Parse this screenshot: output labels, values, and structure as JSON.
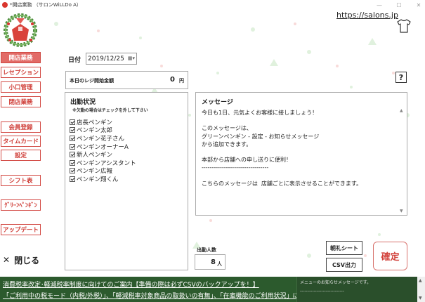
{
  "window": {
    "title": "*開店業務 （サロンWiLLDo A）",
    "minimize": "—",
    "maximize": "☐",
    "close": "✕"
  },
  "header": {
    "url": "https://salons.jp"
  },
  "sidebar": {
    "items": [
      {
        "label": "開店業務"
      },
      {
        "label": "レセプション"
      },
      {
        "label": "小口管理"
      },
      {
        "label": "閉店業務"
      },
      {
        "label": "会員登録"
      },
      {
        "label": "タイムカード"
      },
      {
        "label": "設定"
      },
      {
        "label": "シフト表"
      },
      {
        "label": "ｸﾞﾘｰﾝﾍﾟﾝｷﾞﾝ"
      },
      {
        "label": "アップデート"
      }
    ],
    "close_icon": "✕",
    "close_label": "閉じる"
  },
  "date": {
    "label": "日付",
    "value": "2019/12/25"
  },
  "register": {
    "label": "本日のレジ開始金額",
    "value": "0",
    "unit": "円"
  },
  "help": {
    "label": "?"
  },
  "attendance": {
    "title": "出勤状況",
    "note": "※欠勤の場合はチェックを外して下さい",
    "staff": [
      "店長ペンギン",
      "ペンギン太郎",
      "ペンギン花子さん",
      "ペンギンオーナーA",
      "新人ペンギン",
      "ペンギンアシスタント",
      "ペンギン広報",
      "ペンギン翔くん"
    ]
  },
  "message": {
    "title": "メッセージ",
    "body": "今日も1日、元気よくお客様に接しましょう！\n\nこのメッセージは、\nグリーンペンギン - 設定 - お知らせメッセージ\nから追加できます。\n\n本部から店舗への申し送りに便利！\n---------------------------------\n\nこちらのメッセージは  店舗ごとに表示させることができます。"
  },
  "staff_count": {
    "label": "出勤人数",
    "value": "8",
    "unit": "人"
  },
  "buttons": {
    "morning": "朝礼シート",
    "csv": "CSV出力",
    "confirm": "確定"
  },
  "footer": {
    "line1": "消費税率改定･軽減税率制度に向けてのご案内【準備の際は必ずCSVのバックアップを！】",
    "line2": "「ご利用中の税モード（内税/外税）」、「軽減税率対象商品の取扱いの有無」、「在庫機能のご利用状況」によ",
    "notice_title": "メニューのお知らせメッセージです。",
    "notice_divider": "-----------------------------"
  },
  "colors": {
    "accent": "#d0403a",
    "active_bg": "#e26b67",
    "footer_bg": "#2c5a2d"
  }
}
